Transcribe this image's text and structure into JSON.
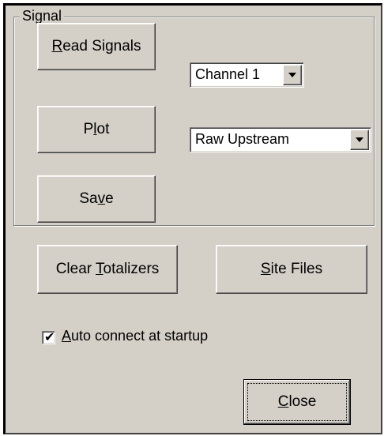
{
  "group": {
    "title": "Signal"
  },
  "buttons": {
    "read_signals": {
      "pre": "",
      "key": "R",
      "post": "ead Signals"
    },
    "plot": {
      "pre": "P",
      "key": "l",
      "post": "ot"
    },
    "save": {
      "pre": "Sa",
      "key": "v",
      "post": "e"
    },
    "clear_totalizers": {
      "pre": "Clear ",
      "key": "T",
      "post": "otalizers"
    },
    "site_files": {
      "pre": "",
      "key": "S",
      "post": "ite Files"
    },
    "close": {
      "pre": "",
      "key": "C",
      "post": "lose"
    }
  },
  "channel_select": {
    "value": "Channel 1"
  },
  "signal_type_select": {
    "value": "Raw Upstream"
  },
  "auto_connect": {
    "checked": true,
    "check_glyph": "✔",
    "pre": "",
    "key": "A",
    "post": "uto connect at startup"
  },
  "colors": {
    "face": "#d4d0c8",
    "highlight": "#ffffff",
    "shadow": "#808080",
    "dark": "#404040"
  }
}
